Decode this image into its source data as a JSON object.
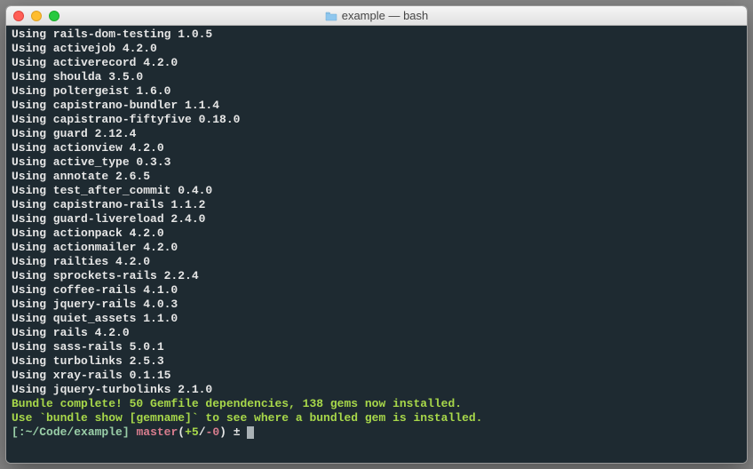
{
  "window": {
    "title": "example — bash"
  },
  "terminal": {
    "lines": [
      "Using rails-dom-testing 1.0.5",
      "Using activejob 4.2.0",
      "Using activerecord 4.2.0",
      "Using shoulda 3.5.0",
      "Using poltergeist 1.6.0",
      "Using capistrano-bundler 1.1.4",
      "Using capistrano-fiftyfive 0.18.0",
      "Using guard 2.12.4",
      "Using actionview 4.2.0",
      "Using active_type 0.3.3",
      "Using annotate 2.6.5",
      "Using test_after_commit 0.4.0",
      "Using capistrano-rails 1.1.2",
      "Using guard-livereload 2.4.0",
      "Using actionpack 4.2.0",
      "Using actionmailer 4.2.0",
      "Using railties 4.2.0",
      "Using sprockets-rails 2.2.4",
      "Using coffee-rails 4.1.0",
      "Using jquery-rails 4.0.3",
      "Using quiet_assets 1.1.0",
      "Using rails 4.2.0",
      "Using sass-rails 5.0.1",
      "Using turbolinks 2.5.3",
      "Using xray-rails 0.1.15",
      "Using jquery-turbolinks 2.1.0"
    ],
    "success_lines": [
      "Bundle complete! 50 Gemfile dependencies, 138 gems now installed.",
      "Use `bundle show [gemname]` to see where a bundled gem is installed."
    ],
    "prompt": {
      "bracket_open": "[",
      "path": ":~/Code/example",
      "bracket_close": "]",
      "branch": "master",
      "diff_open": "(",
      "diff_plus": "+5",
      "diff_slash": "/",
      "diff_minus": "-0",
      "diff_close": ")",
      "symbol": " ± "
    }
  }
}
